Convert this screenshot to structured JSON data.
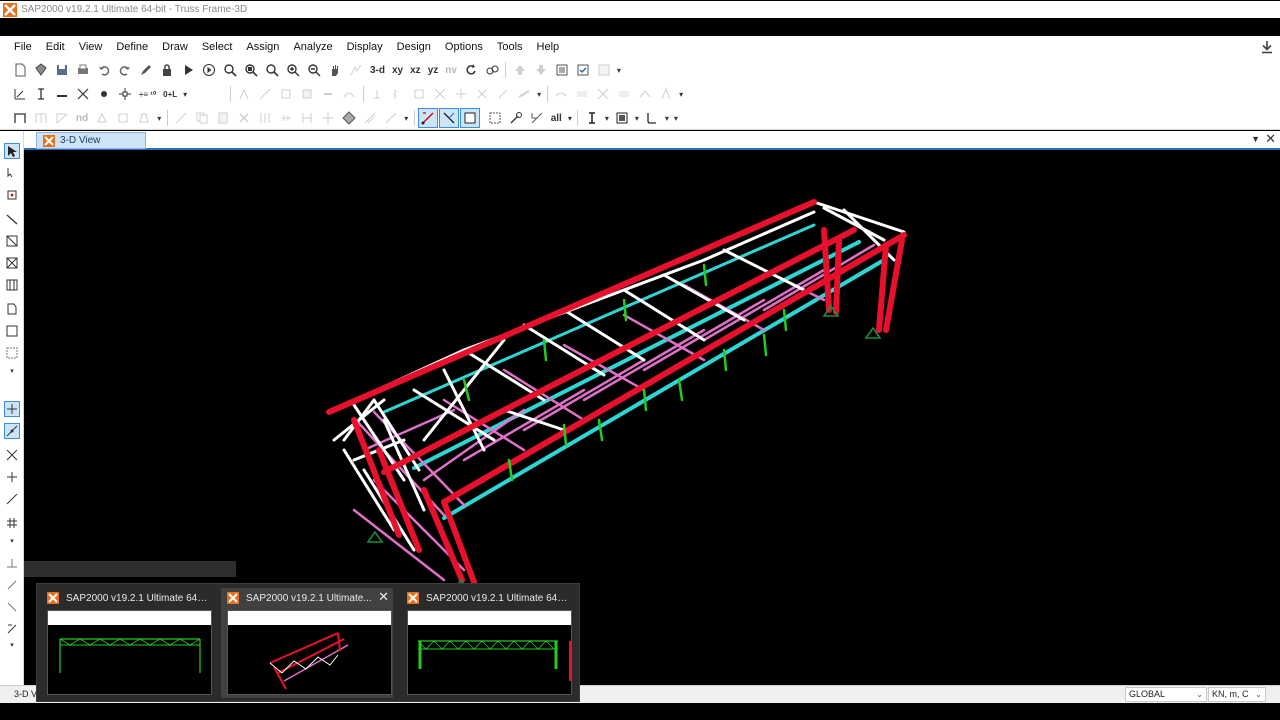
{
  "window": {
    "title": "SAP2000 v19.2.1 Ultimate 64-bit - Truss Frame-3D"
  },
  "menu": [
    "File",
    "Edit",
    "View",
    "Define",
    "Draw",
    "Select",
    "Assign",
    "Analyze",
    "Display",
    "Design",
    "Options",
    "Tools",
    "Help"
  ],
  "toolbar": {
    "view_3d": "3-d",
    "view_xy": "xy",
    "view_xz": "xz",
    "view_yz": "yz",
    "view_nv": "nv",
    "nd_label": "nd"
  },
  "tab": {
    "label": "3-D View"
  },
  "status": {
    "view_label": "3-D V",
    "coord_system": "GLOBAL",
    "units": "KN, m, C"
  },
  "taskbar_previews": [
    {
      "title": "SAP2000 v19.2.1 Ultimate 64-bi...",
      "thumbnail": "2d-frame-green"
    },
    {
      "title": "SAP2000 v19.2.1 Ultimate...",
      "thumbnail": "3d-truss"
    },
    {
      "title": "SAP2000 v19.2.1 Ultimate 64-bi...",
      "thumbnail": "2d-frame-green-braced"
    }
  ],
  "colors": {
    "column_red": "#e8112d",
    "truss_white": "#ffffff",
    "brace_pink": "#e070c8",
    "purlin_cyan": "#2fd5d5",
    "web_green": "#22cc22",
    "support_green": "#1f8a3a",
    "app_orange": "#e8701a"
  }
}
